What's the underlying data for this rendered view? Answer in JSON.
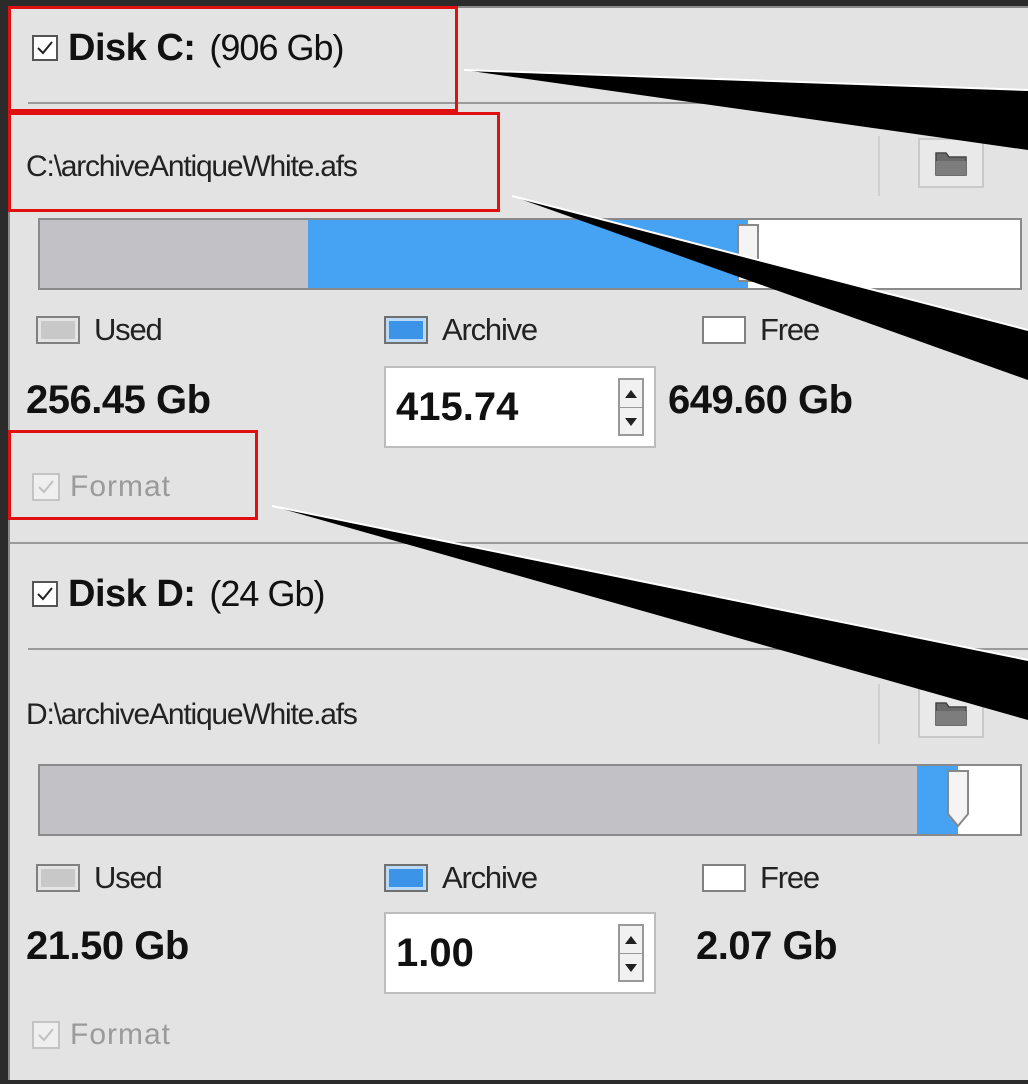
{
  "disks": [
    {
      "checked": true,
      "name": "Disk C:",
      "size": "(906 Gb)",
      "path": "C:\\archiveAntiqueWhite.afs",
      "usage": {
        "used_fraction": 0.273,
        "archive_fraction": 0.449
      },
      "legend": {
        "used": "Used",
        "archive": "Archive",
        "free": "Free"
      },
      "used_value": "256.45 Gb",
      "archive_value": "415.74",
      "free_value": "649.60 Gb",
      "format": {
        "checked": true,
        "enabled": false,
        "label": "Format"
      }
    },
    {
      "checked": true,
      "name": "Disk D:",
      "size": "(24 Gb)",
      "path": "D:\\archiveAntiqueWhite.afs",
      "usage": {
        "used_fraction": 0.895,
        "archive_fraction": 0.042
      },
      "legend": {
        "used": "Used",
        "archive": "Archive",
        "free": "Free"
      },
      "used_value": "21.50 Gb",
      "archive_value": "1.00",
      "free_value": "2.07 Gb",
      "format": {
        "checked": true,
        "enabled": false,
        "label": "Format"
      }
    }
  ],
  "icons": {
    "checkbox": "checkmark-icon",
    "browse": "folder-icon",
    "spin_up": "arrow-up-icon",
    "spin_down": "arrow-down-icon"
  },
  "colors": {
    "used": "#c2c2c6",
    "archive": "#46a2f2",
    "free": "#ffffff",
    "highlight": "#e01010",
    "background": "#e3e3e3"
  }
}
